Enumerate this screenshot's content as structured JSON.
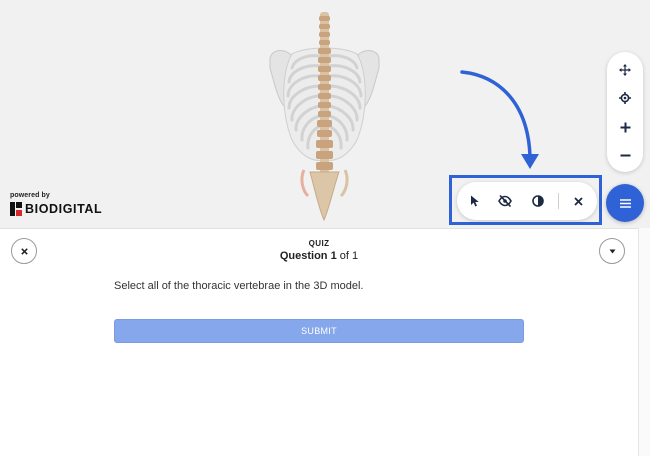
{
  "viewer": {
    "brand_powered": "powered by",
    "brand_name": "BIODIGITAL",
    "nav_controls": [
      "move-icon",
      "center-icon",
      "zoom-in-icon",
      "zoom-out-icon"
    ],
    "tool_controls": [
      "select-icon",
      "hide-icon",
      "xray-icon",
      "close-icon"
    ],
    "menu_icon": "menu-icon",
    "accent_color": "#2f62d6"
  },
  "quiz": {
    "label": "QUIZ",
    "question_word": "Question",
    "question_number": "1",
    "of_text": "of",
    "total": "1",
    "question_text": "Select all of the thoracic vertebrae in the 3D model.",
    "submit_label": "SUBMIT",
    "submit_color": "#86a7eb"
  }
}
